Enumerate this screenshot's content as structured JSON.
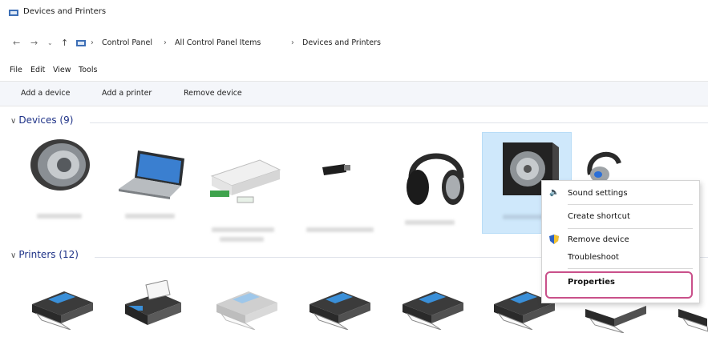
{
  "window": {
    "title": "Devices and Printers"
  },
  "address": {
    "back_icon": "arrow-left-icon",
    "forward_icon": "arrow-right-icon",
    "dropdown_icon": "chevron-down-icon",
    "up_icon": "arrow-up-icon",
    "crumbs": [
      "Control Panel",
      "All Control Panel Items",
      "Devices and Printers"
    ],
    "separator": "›"
  },
  "menu": {
    "file": "File",
    "edit": "Edit",
    "view": "View",
    "tools": "Tools"
  },
  "commands": {
    "add_device": "Add a device",
    "add_printer": "Add a printer",
    "remove_device": "Remove device"
  },
  "groups": {
    "devices": {
      "label": "Devices (9)"
    },
    "printers": {
      "label": "Printers (12)"
    }
  },
  "context_menu": {
    "sound_settings": "Sound settings",
    "create_shortcut": "Create shortcut",
    "remove_device": "Remove device",
    "troubleshoot": "Troubleshoot",
    "properties": "Properties"
  },
  "colors": {
    "accent": "#1e3287",
    "selection": "#cfe8fb",
    "highlight_ring": "#c9508a",
    "command_bar": "#f4f6fa"
  }
}
